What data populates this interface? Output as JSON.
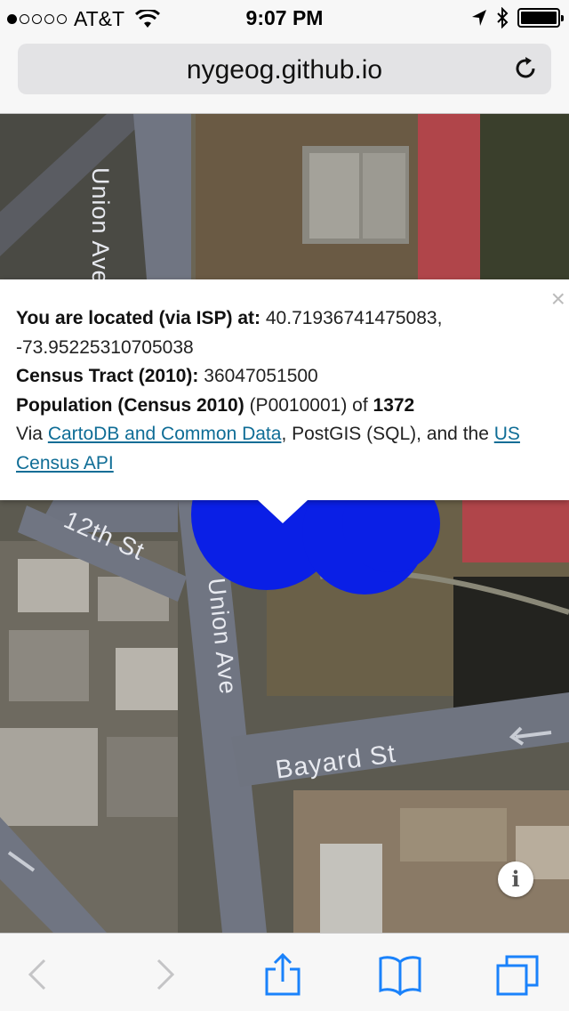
{
  "status": {
    "carrier": "AT&T",
    "time": "9:07 PM"
  },
  "browser": {
    "url": "nygeog.github.io"
  },
  "map": {
    "street_labels": [
      "Union Ave",
      "12th St",
      "Union Ave",
      "Bayard St"
    ]
  },
  "popup": {
    "location_label": "You are located (via ISP) at:",
    "location_value": "40.71936741475083, -73.95225310705038",
    "tract_label": "Census Tract (2010):",
    "tract_value": "36047051500",
    "population_label": "Population (Census 2010)",
    "population_code": "(P0010001) of",
    "population_value": "1372",
    "via_prefix": "Via",
    "link_cartodb": "CartoDB and Common Data",
    "via_middle": ", PostGIS (SQL), and the",
    "link_census": "US Census API",
    "close": "×"
  },
  "info_button": "i",
  "colors": {
    "marker": "#0a1fe6",
    "link": "#0f6d96",
    "ios_blue": "#1a82fb"
  }
}
